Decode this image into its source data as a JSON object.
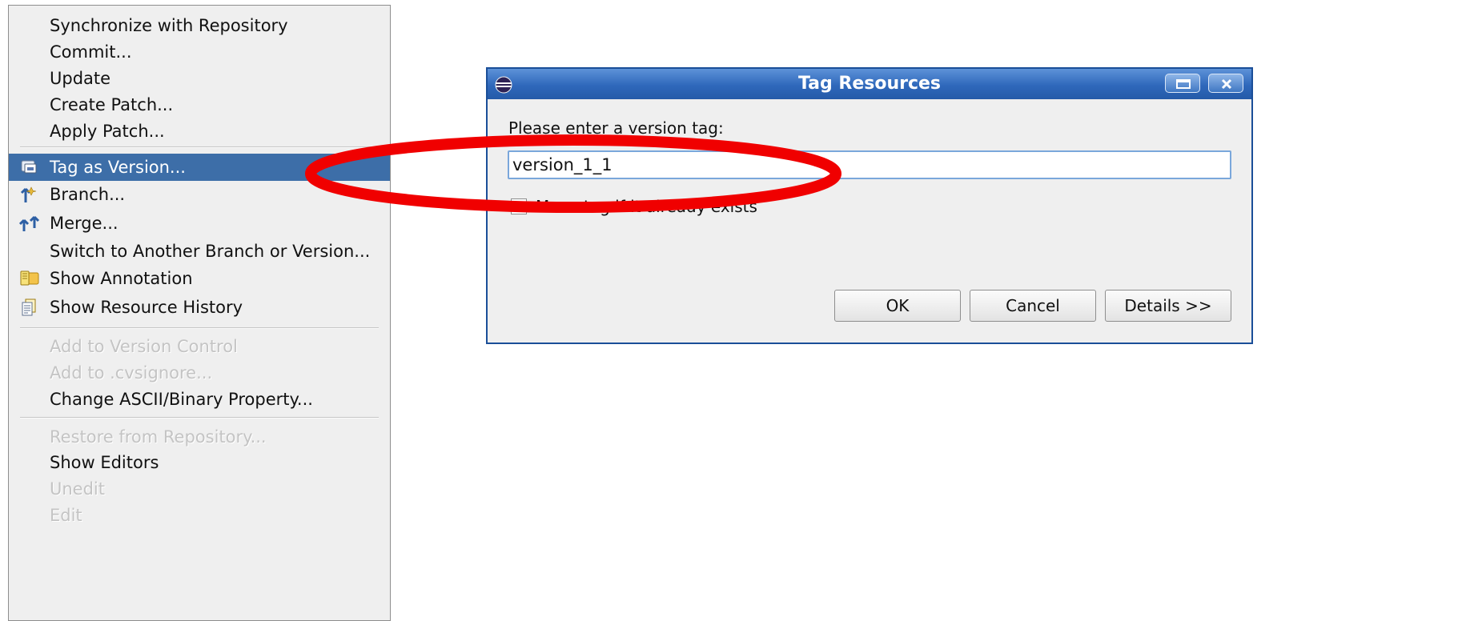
{
  "context_menu": {
    "items": [
      {
        "label": "Synchronize with Repository",
        "mnemonic": "S",
        "state": "normal",
        "icon": null
      },
      {
        "label": "Commit...",
        "mnemonic": "C",
        "state": "normal",
        "icon": null
      },
      {
        "label": "Update",
        "mnemonic": "U",
        "state": "normal",
        "icon": null
      },
      {
        "label": "Create Patch...",
        "mnemonic": "P",
        "state": "normal",
        "icon": null
      },
      {
        "label": "Apply Patch...",
        "mnemonic": "A",
        "state": "normal",
        "icon": null
      },
      {
        "label": "Tag as Version...",
        "mnemonic": "T",
        "state": "selected",
        "icon": "tag-icon"
      },
      {
        "label": "Branch...",
        "mnemonic": "B",
        "state": "normal",
        "icon": "branch-icon"
      },
      {
        "label": "Merge...",
        "mnemonic": "M",
        "state": "normal",
        "icon": "merge-icon"
      },
      {
        "label": "Switch to Another Branch or Version...",
        "mnemonic": "w",
        "state": "normal",
        "icon": null
      },
      {
        "label": "Show Annotation",
        "mnemonic": "A",
        "state": "normal",
        "icon": "annotation-icon"
      },
      {
        "label": "Show Resource History",
        "mnemonic": "H",
        "state": "normal",
        "icon": "history-icon"
      },
      {
        "label": "Add to Version Control",
        "mnemonic": "V",
        "state": "disabled",
        "icon": null
      },
      {
        "label": "Add to .cvsignore...",
        "mnemonic": "",
        "state": "disabled",
        "icon": null
      },
      {
        "label": "Change ASCII/Binary Property...",
        "mnemonic": "n",
        "state": "normal",
        "icon": null
      },
      {
        "label": "Restore from Repository...",
        "mnemonic": "R",
        "state": "disabled",
        "icon": null
      },
      {
        "label": "Show Editors",
        "mnemonic": "E",
        "state": "normal",
        "icon": null
      },
      {
        "label": "Unedit",
        "mnemonic": "n",
        "state": "disabled",
        "icon": null
      },
      {
        "label": "Edit",
        "mnemonic": "E",
        "state": "disabled",
        "icon": null
      }
    ]
  },
  "dialog": {
    "title": "Tag Resources",
    "prompt": "Please enter a version tag:",
    "tag_value": "version_1_1",
    "checkbox_label": "Move tag if it already exists",
    "checkbox_checked": false,
    "buttons": {
      "ok": "OK",
      "cancel": "Cancel",
      "details": "Details >>"
    }
  },
  "colors": {
    "selection": "#3d6ea8",
    "titlebar": "#2f68bb",
    "annotation_ellipse": "#f00000"
  }
}
